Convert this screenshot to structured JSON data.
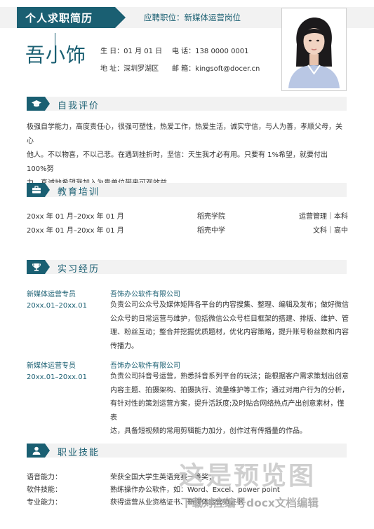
{
  "header": {
    "title": "个人求职简历",
    "job_intention": "应聘职位：新媒体运营岗位"
  },
  "profile": {
    "name": "吾小饰",
    "birthday": "生  日：01 月 01 日",
    "phone": "电  话：138 0000 0001",
    "address": "地  址：深圳罗湖区",
    "email": "邮  箱：kingsoft@docer.cn"
  },
  "sections": {
    "self_eval": {
      "title": "自我评价",
      "icon": "graduation-cap-icon",
      "line1": "极强自学能力，高度责任心，很强可塑性，热爱工作，热爱生活，诚实守信，与人为善，孝顺父母，关心",
      "line2": "他人。不以物喜，不以己悲。在遇到挫折时，坚信：天生我才必有用。只要有 1%希望，就要付出 100%努",
      "line3": "力。真诚地希望我加入为贵单位带来可观效益。"
    },
    "education": {
      "title": "教育培训",
      "icon": "briefcase-icon",
      "rows": [
        {
          "period": "20xx 年 01 月–20xx 年 01 月",
          "school": "稻壳学院",
          "major": "运营管理｜本科"
        },
        {
          "period": "20xx 年 01 月–20xx 年 01 月",
          "school": "稻壳中学",
          "major": "文科｜高中"
        }
      ]
    },
    "internship": {
      "title": "实习经历",
      "icon": "trophy-icon",
      "items": [
        {
          "role": "新媒体运营专员",
          "company": "吾饰办公软件有限公司",
          "period": "20xx.01–20xx.01",
          "line1": "负责公司公众号及媒体矩阵各平台的内容搜集、整理、编辑及发布；做好微信",
          "line2": "公众号的日常运营与维护，包括微信公众号栏目框架的搭建、排版、维护、管",
          "line3": "理、粉丝互动；整合并挖掘优质题材，优化内容策略，提升账号粉丝数和内容",
          "line4": "传播力。"
        },
        {
          "role": "新媒体运营专员",
          "company": "吾饰办公软件有限公司",
          "period": "20xx.01–20xx.01",
          "line1": "负责公司抖音号运营，熟悉抖音系列平台的玩法；能根据客户需求策划出创意",
          "line2": "内容主题、拍摄架构、拍摄执行、流量维护等工作；通过对用户行为的分析，",
          "line3": "有针对性的策划运营方案，提升活跃度;及时贴合网络热点产出创意素材，懂表",
          "line4": "达，具备短视频的常用剪辑能力加分，创作过有传播量的作品。"
        }
      ]
    },
    "skills": {
      "title": "职业技能",
      "icon": "person-icon",
      "rows": [
        {
          "label": "语音能力：",
          "value": "荣获全国大学生英语竞赛一等奖；"
        },
        {
          "label": "软件技能：",
          "value": "熟练操作办公软件，如：Word、Excel、power point"
        },
        {
          "label": "专业能力：",
          "value": "获得运营从业资格证书、新媒体运营师证书"
        }
      ]
    }
  },
  "watermark": {
    "main": "这是预览图",
    "sub": "下载对应编号docx文档编辑"
  },
  "colors": {
    "accent": "#1a5f72",
    "band": "#f2f2f2"
  }
}
